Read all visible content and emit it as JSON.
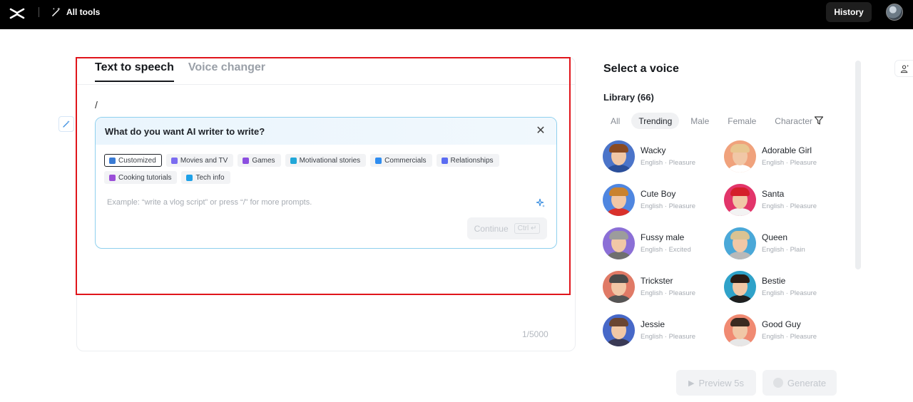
{
  "topbar": {
    "logo_icon": "capcut-logo-icon",
    "all_tools_label": "All tools",
    "history_label": "History"
  },
  "editor": {
    "tabs": [
      {
        "label": "Text to speech",
        "active": true
      },
      {
        "label": "Voice changer",
        "active": false
      }
    ],
    "text_value": "/",
    "char_counter": "1/5000"
  },
  "ai_writer": {
    "title": "What do you want AI writer to write?",
    "chips": [
      {
        "label": "Customized",
        "icon": "pencil-icon",
        "color": "#3a7bd5",
        "selected": true
      },
      {
        "label": "Movies and TV",
        "icon": "clapper-icon",
        "color": "#7b6cf0",
        "selected": false
      },
      {
        "label": "Games",
        "icon": "gamepad-icon",
        "color": "#8c4fe0",
        "selected": false
      },
      {
        "label": "Motivational stories",
        "icon": "flag-icon",
        "color": "#21a7d8",
        "selected": false
      },
      {
        "label": "Commercials",
        "icon": "monitor-icon",
        "color": "#2f8df0",
        "selected": false
      },
      {
        "label": "Relationships",
        "icon": "people-icon",
        "color": "#5b6cf2",
        "selected": false
      },
      {
        "label": "Cooking tutorials",
        "icon": "cup-icon",
        "color": "#9b4fd8",
        "selected": false
      },
      {
        "label": "Tech info",
        "icon": "rocket-icon",
        "color": "#1ea1e8",
        "selected": false
      }
    ],
    "prompt_placeholder": "Example: “write a vlog script” or press “/” for more prompts.",
    "continue_label": "Continue",
    "continue_shortcut": "Ctrl ↵"
  },
  "voice_panel": {
    "title": "Select a voice",
    "library_label": "Library (66)",
    "filters": [
      {
        "label": "All",
        "active": false
      },
      {
        "label": "Trending",
        "active": true
      },
      {
        "label": "Male",
        "active": false
      },
      {
        "label": "Female",
        "active": false
      },
      {
        "label": "Character",
        "active": false
      }
    ],
    "voices": [
      {
        "name": "Wacky",
        "meta": "English · Pleasure",
        "bg": "#4b74c9",
        "hair": "#8a4a22",
        "body": "#2b4f9a"
      },
      {
        "name": "Adorable Girl",
        "meta": "English · Pleasure",
        "bg": "#f0a27c",
        "hair": "#e8c690",
        "body": "#ffffff"
      },
      {
        "name": "Cute Boy",
        "meta": "English · Pleasure",
        "bg": "#4f86e0",
        "hair": "#c9822f",
        "body": "#d9312b"
      },
      {
        "name": "Santa",
        "meta": "English · Pleasure",
        "bg": "#e2356a",
        "hair": "#d41f2a",
        "body": "#f3f3f3"
      },
      {
        "name": "Fussy male",
        "meta": "English · Excited",
        "bg": "#8b6fd6",
        "hair": "#9c9c9c",
        "body": "#6f6f6f"
      },
      {
        "name": "Queen",
        "meta": "English · Plain",
        "bg": "#4aa8d8",
        "hair": "#d9c392",
        "body": "#b9b9b9"
      },
      {
        "name": "Trickster",
        "meta": "English · Pleasure",
        "bg": "#e07a66",
        "hair": "#4a4a4a",
        "body": "#555555"
      },
      {
        "name": "Bestie",
        "meta": "English · Pleasure",
        "bg": "#2fa2c9",
        "hair": "#2a1b14",
        "body": "#1f1f1f"
      },
      {
        "name": "Jessie",
        "meta": "English · Pleasure",
        "bg": "#4768c8",
        "hair": "#6a4532",
        "body": "#3a3a55"
      },
      {
        "name": "Good Guy",
        "meta": "English · Pleasure",
        "bg": "#f08a72",
        "hair": "#3b2a20",
        "body": "#e7e7e7"
      }
    ]
  },
  "actions": {
    "preview_label": "Preview 5s",
    "generate_label": "Generate"
  },
  "colors": {
    "highlight": "#e0151b",
    "panel_border": "#8fd0ee"
  }
}
